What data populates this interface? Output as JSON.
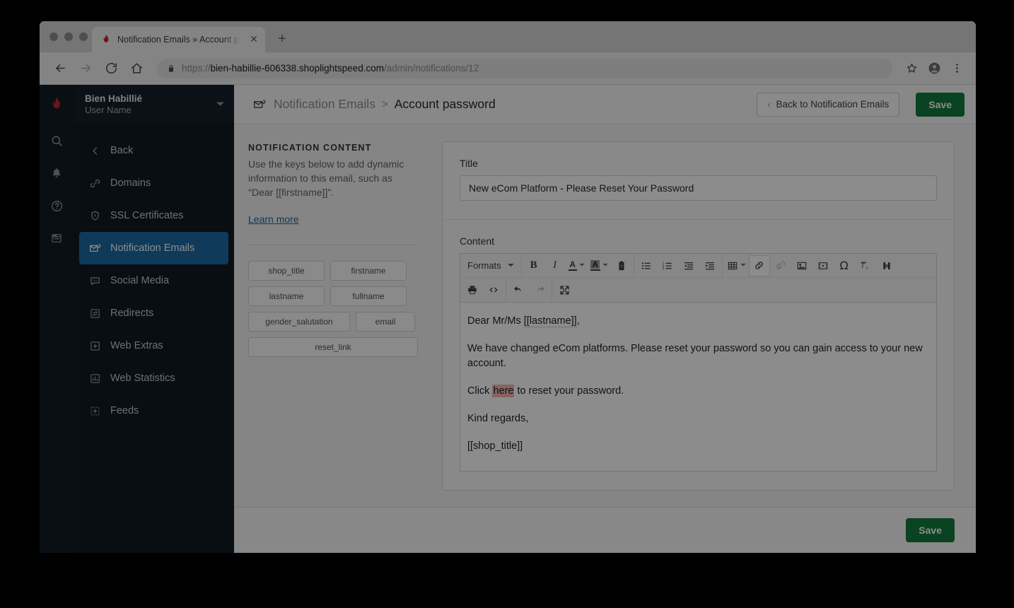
{
  "browser": {
    "tab_title": "Notification Emails » Account p",
    "tab_close_label": "✕",
    "new_tab_label": "+",
    "url_protocol": "https://",
    "url_host": "bien-habillie-606338.shoplightspeed.com",
    "url_path": "/admin/notifications/12"
  },
  "sidebar": {
    "shop_name": "Bien Habillié",
    "user_name": "User Name",
    "rail_icons": [
      "search-icon",
      "bell-icon",
      "help-icon",
      "browser-icon"
    ],
    "items": [
      {
        "label": "Back",
        "icon": "chevron-left-icon",
        "active": false
      },
      {
        "label": "Domains",
        "icon": "link-icon",
        "active": false
      },
      {
        "label": "SSL Certificates",
        "icon": "shield-icon",
        "active": false
      },
      {
        "label": "Notification Emails",
        "icon": "mail-check-icon",
        "active": true
      },
      {
        "label": "Social Media",
        "icon": "chat-icon",
        "active": false
      },
      {
        "label": "Redirects",
        "icon": "redirect-icon",
        "active": false
      },
      {
        "label": "Web Extras",
        "icon": "plus-box-icon",
        "active": false
      },
      {
        "label": "Web Statistics",
        "icon": "chart-box-icon",
        "active": false
      },
      {
        "label": "Feeds",
        "icon": "dotted-plus-icon",
        "active": false
      }
    ]
  },
  "header": {
    "breadcrumb_icon": "mail-check-icon",
    "crumb_parent": "Notification Emails",
    "crumb_separator": ">",
    "crumb_current": "Account password",
    "back_button": "Back to Notification Emails",
    "back_button_chevron": "‹",
    "save_button": "Save"
  },
  "info_panel": {
    "heading": "NOTIFICATION CONTENT",
    "description": "Use the keys below to add dynamic information to this email, such as \"Dear [[firstname]]\".",
    "learn_more": "Learn more",
    "keys": [
      {
        "label": "shop_title",
        "size": "half"
      },
      {
        "label": "firstname",
        "size": "half"
      },
      {
        "label": "lastname",
        "size": "half"
      },
      {
        "label": "fullname",
        "size": "half"
      },
      {
        "label": "gender_salutation",
        "size": "wide"
      },
      {
        "label": "email",
        "size": "narrow"
      },
      {
        "label": "reset_link",
        "size": "full"
      }
    ]
  },
  "form": {
    "title_label": "Title",
    "title_value": "New eCom Platform - Please Reset Your Password",
    "content_label": "Content"
  },
  "editor": {
    "toolbar_row1": [
      {
        "name": "formats-dropdown",
        "label": "Formats",
        "type": "text",
        "caret": true,
        "group": 0
      },
      {
        "name": "bold-button",
        "glyph": "B",
        "type": "bold",
        "group": 1
      },
      {
        "name": "italic-button",
        "glyph": "I",
        "type": "italic",
        "group": 1
      },
      {
        "name": "text-color-button",
        "glyph": "A",
        "type": "forecolor",
        "caret": true,
        "group": 1
      },
      {
        "name": "background-color-button",
        "glyph": "A",
        "type": "backcolor",
        "caret": true,
        "group": 1
      },
      {
        "name": "paste-text-button",
        "type": "pastetext",
        "group": 1
      },
      {
        "name": "bullet-list-button",
        "type": "ul",
        "group": 2
      },
      {
        "name": "numbered-list-button",
        "type": "ol",
        "group": 2
      },
      {
        "name": "outdent-button",
        "type": "outdent",
        "group": 2
      },
      {
        "name": "indent-button",
        "type": "indent",
        "group": 2
      },
      {
        "name": "table-button",
        "type": "table",
        "caret": true,
        "group": 3
      },
      {
        "name": "insert-link-button",
        "type": "link",
        "active": true,
        "group": 3
      },
      {
        "name": "unlink-button",
        "type": "unlink",
        "disabled": true,
        "group": 3
      },
      {
        "name": "insert-image-button",
        "type": "image",
        "group": 3
      },
      {
        "name": "insert-media-button",
        "type": "media",
        "group": 3
      },
      {
        "name": "special-character-button",
        "type": "charmap",
        "group": 3
      },
      {
        "name": "remove-format-button",
        "type": "removeformat",
        "group": 3
      },
      {
        "name": "search-replace-button",
        "type": "searchreplace",
        "group": 3
      }
    ],
    "toolbar_row2": [
      {
        "name": "print-button",
        "type": "print",
        "group": 0
      },
      {
        "name": "source-code-button",
        "type": "code",
        "group": 0
      },
      {
        "name": "undo-button",
        "type": "undo",
        "group": 1
      },
      {
        "name": "redo-button",
        "type": "redo",
        "disabled": true,
        "group": 1
      },
      {
        "name": "fullscreen-button",
        "type": "fullscreen",
        "group": 2
      }
    ],
    "body": {
      "p1_pre": "Dear Mr/Ms ",
      "p1_tag": "[[lastname]]",
      "p1_post": ",",
      "p2": "We have changed eCom platforms. Please reset your password so you can gain access to your new account.",
      "p3_pre": "Click ",
      "p3_link": "here",
      "p3_post": " to reset your password.",
      "p4": "Kind regards,",
      "p5": "[[shop_title]]"
    }
  },
  "footer": {
    "save_button": "Save"
  },
  "colors": {
    "sidebar_bg": "#111a23",
    "rail_bg": "#131c26",
    "active_nav": "#1d6aa5",
    "save_green": "#137a3d",
    "link_blue": "#1d6aa5",
    "selection_pink": "#f8b4b4",
    "brand_red": "#c8232c"
  }
}
